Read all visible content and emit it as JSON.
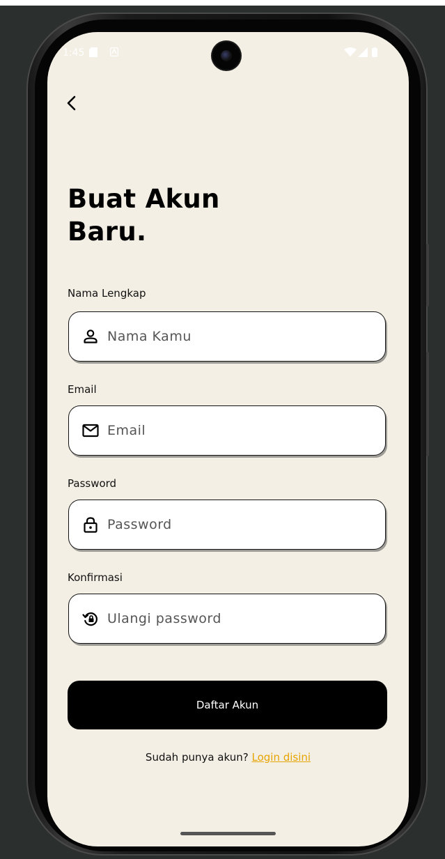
{
  "status_bar": {
    "time": "1:45",
    "icons": [
      "sim-card-icon",
      "notification-icon",
      "wifi-icon",
      "signal-icon",
      "battery-icon"
    ]
  },
  "header": {
    "back_icon": "chevron-left-icon",
    "title_line1": "Buat Akun",
    "title_line2": "Baru."
  },
  "form": {
    "name": {
      "label": "Nama Lengkap",
      "placeholder": "Nama Kamu",
      "value": "",
      "icon": "user-icon"
    },
    "email": {
      "label": "Email",
      "placeholder": "Email",
      "value": "",
      "icon": "mail-icon"
    },
    "password": {
      "label": "Password",
      "placeholder": "Password",
      "value": "",
      "icon": "lock-icon"
    },
    "confirm": {
      "label": "Konfirmasi",
      "placeholder": "Ulangi password",
      "value": "",
      "icon": "lock-reset-icon"
    },
    "submit_label": "Daftar Akun"
  },
  "footer": {
    "prompt": "Sudah punya akun?",
    "link": "Login disini"
  },
  "colors": {
    "background": "#f3efe4",
    "button": "#000000",
    "link": "#e6a400"
  }
}
